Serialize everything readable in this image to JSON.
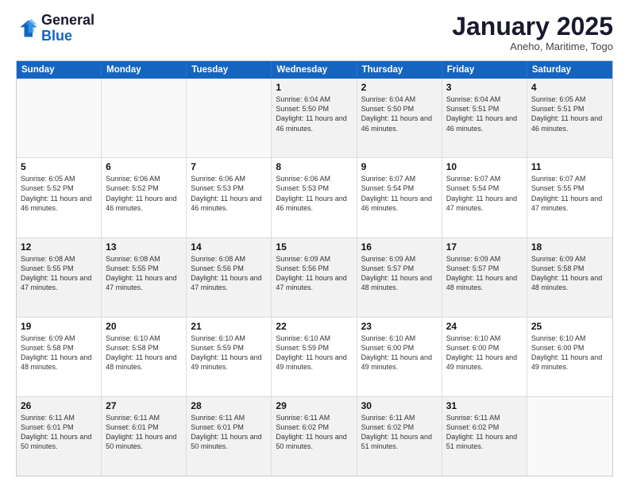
{
  "logo": {
    "line1": "General",
    "line2": "Blue"
  },
  "title": "January 2025",
  "subtitle": "Aneho, Maritime, Togo",
  "headers": [
    "Sunday",
    "Monday",
    "Tuesday",
    "Wednesday",
    "Thursday",
    "Friday",
    "Saturday"
  ],
  "weeks": [
    [
      {
        "day": "",
        "info": ""
      },
      {
        "day": "",
        "info": ""
      },
      {
        "day": "",
        "info": ""
      },
      {
        "day": "1",
        "info": "Sunrise: 6:04 AM\nSunset: 5:50 PM\nDaylight: 11 hours and 46 minutes."
      },
      {
        "day": "2",
        "info": "Sunrise: 6:04 AM\nSunset: 5:50 PM\nDaylight: 11 hours and 46 minutes."
      },
      {
        "day": "3",
        "info": "Sunrise: 6:04 AM\nSunset: 5:51 PM\nDaylight: 11 hours and 46 minutes."
      },
      {
        "day": "4",
        "info": "Sunrise: 6:05 AM\nSunset: 5:51 PM\nDaylight: 11 hours and 46 minutes."
      }
    ],
    [
      {
        "day": "5",
        "info": "Sunrise: 6:05 AM\nSunset: 5:52 PM\nDaylight: 11 hours and 46 minutes."
      },
      {
        "day": "6",
        "info": "Sunrise: 6:06 AM\nSunset: 5:52 PM\nDaylight: 11 hours and 46 minutes."
      },
      {
        "day": "7",
        "info": "Sunrise: 6:06 AM\nSunset: 5:53 PM\nDaylight: 11 hours and 46 minutes."
      },
      {
        "day": "8",
        "info": "Sunrise: 6:06 AM\nSunset: 5:53 PM\nDaylight: 11 hours and 46 minutes."
      },
      {
        "day": "9",
        "info": "Sunrise: 6:07 AM\nSunset: 5:54 PM\nDaylight: 11 hours and 46 minutes."
      },
      {
        "day": "10",
        "info": "Sunrise: 6:07 AM\nSunset: 5:54 PM\nDaylight: 11 hours and 47 minutes."
      },
      {
        "day": "11",
        "info": "Sunrise: 6:07 AM\nSunset: 5:55 PM\nDaylight: 11 hours and 47 minutes."
      }
    ],
    [
      {
        "day": "12",
        "info": "Sunrise: 6:08 AM\nSunset: 5:55 PM\nDaylight: 11 hours and 47 minutes."
      },
      {
        "day": "13",
        "info": "Sunrise: 6:08 AM\nSunset: 5:55 PM\nDaylight: 11 hours and 47 minutes."
      },
      {
        "day": "14",
        "info": "Sunrise: 6:08 AM\nSunset: 5:56 PM\nDaylight: 11 hours and 47 minutes."
      },
      {
        "day": "15",
        "info": "Sunrise: 6:09 AM\nSunset: 5:56 PM\nDaylight: 11 hours and 47 minutes."
      },
      {
        "day": "16",
        "info": "Sunrise: 6:09 AM\nSunset: 5:57 PM\nDaylight: 11 hours and 48 minutes."
      },
      {
        "day": "17",
        "info": "Sunrise: 6:09 AM\nSunset: 5:57 PM\nDaylight: 11 hours and 48 minutes."
      },
      {
        "day": "18",
        "info": "Sunrise: 6:09 AM\nSunset: 5:58 PM\nDaylight: 11 hours and 48 minutes."
      }
    ],
    [
      {
        "day": "19",
        "info": "Sunrise: 6:09 AM\nSunset: 5:58 PM\nDaylight: 11 hours and 48 minutes."
      },
      {
        "day": "20",
        "info": "Sunrise: 6:10 AM\nSunset: 5:58 PM\nDaylight: 11 hours and 48 minutes."
      },
      {
        "day": "21",
        "info": "Sunrise: 6:10 AM\nSunset: 5:59 PM\nDaylight: 11 hours and 49 minutes."
      },
      {
        "day": "22",
        "info": "Sunrise: 6:10 AM\nSunset: 5:59 PM\nDaylight: 11 hours and 49 minutes."
      },
      {
        "day": "23",
        "info": "Sunrise: 6:10 AM\nSunset: 6:00 PM\nDaylight: 11 hours and 49 minutes."
      },
      {
        "day": "24",
        "info": "Sunrise: 6:10 AM\nSunset: 6:00 PM\nDaylight: 11 hours and 49 minutes."
      },
      {
        "day": "25",
        "info": "Sunrise: 6:10 AM\nSunset: 6:00 PM\nDaylight: 11 hours and 49 minutes."
      }
    ],
    [
      {
        "day": "26",
        "info": "Sunrise: 6:11 AM\nSunset: 6:01 PM\nDaylight: 11 hours and 50 minutes."
      },
      {
        "day": "27",
        "info": "Sunrise: 6:11 AM\nSunset: 6:01 PM\nDaylight: 11 hours and 50 minutes."
      },
      {
        "day": "28",
        "info": "Sunrise: 6:11 AM\nSunset: 6:01 PM\nDaylight: 11 hours and 50 minutes."
      },
      {
        "day": "29",
        "info": "Sunrise: 6:11 AM\nSunset: 6:02 PM\nDaylight: 11 hours and 50 minutes."
      },
      {
        "day": "30",
        "info": "Sunrise: 6:11 AM\nSunset: 6:02 PM\nDaylight: 11 hours and 51 minutes."
      },
      {
        "day": "31",
        "info": "Sunrise: 6:11 AM\nSunset: 6:02 PM\nDaylight: 11 hours and 51 minutes."
      },
      {
        "day": "",
        "info": ""
      }
    ]
  ]
}
